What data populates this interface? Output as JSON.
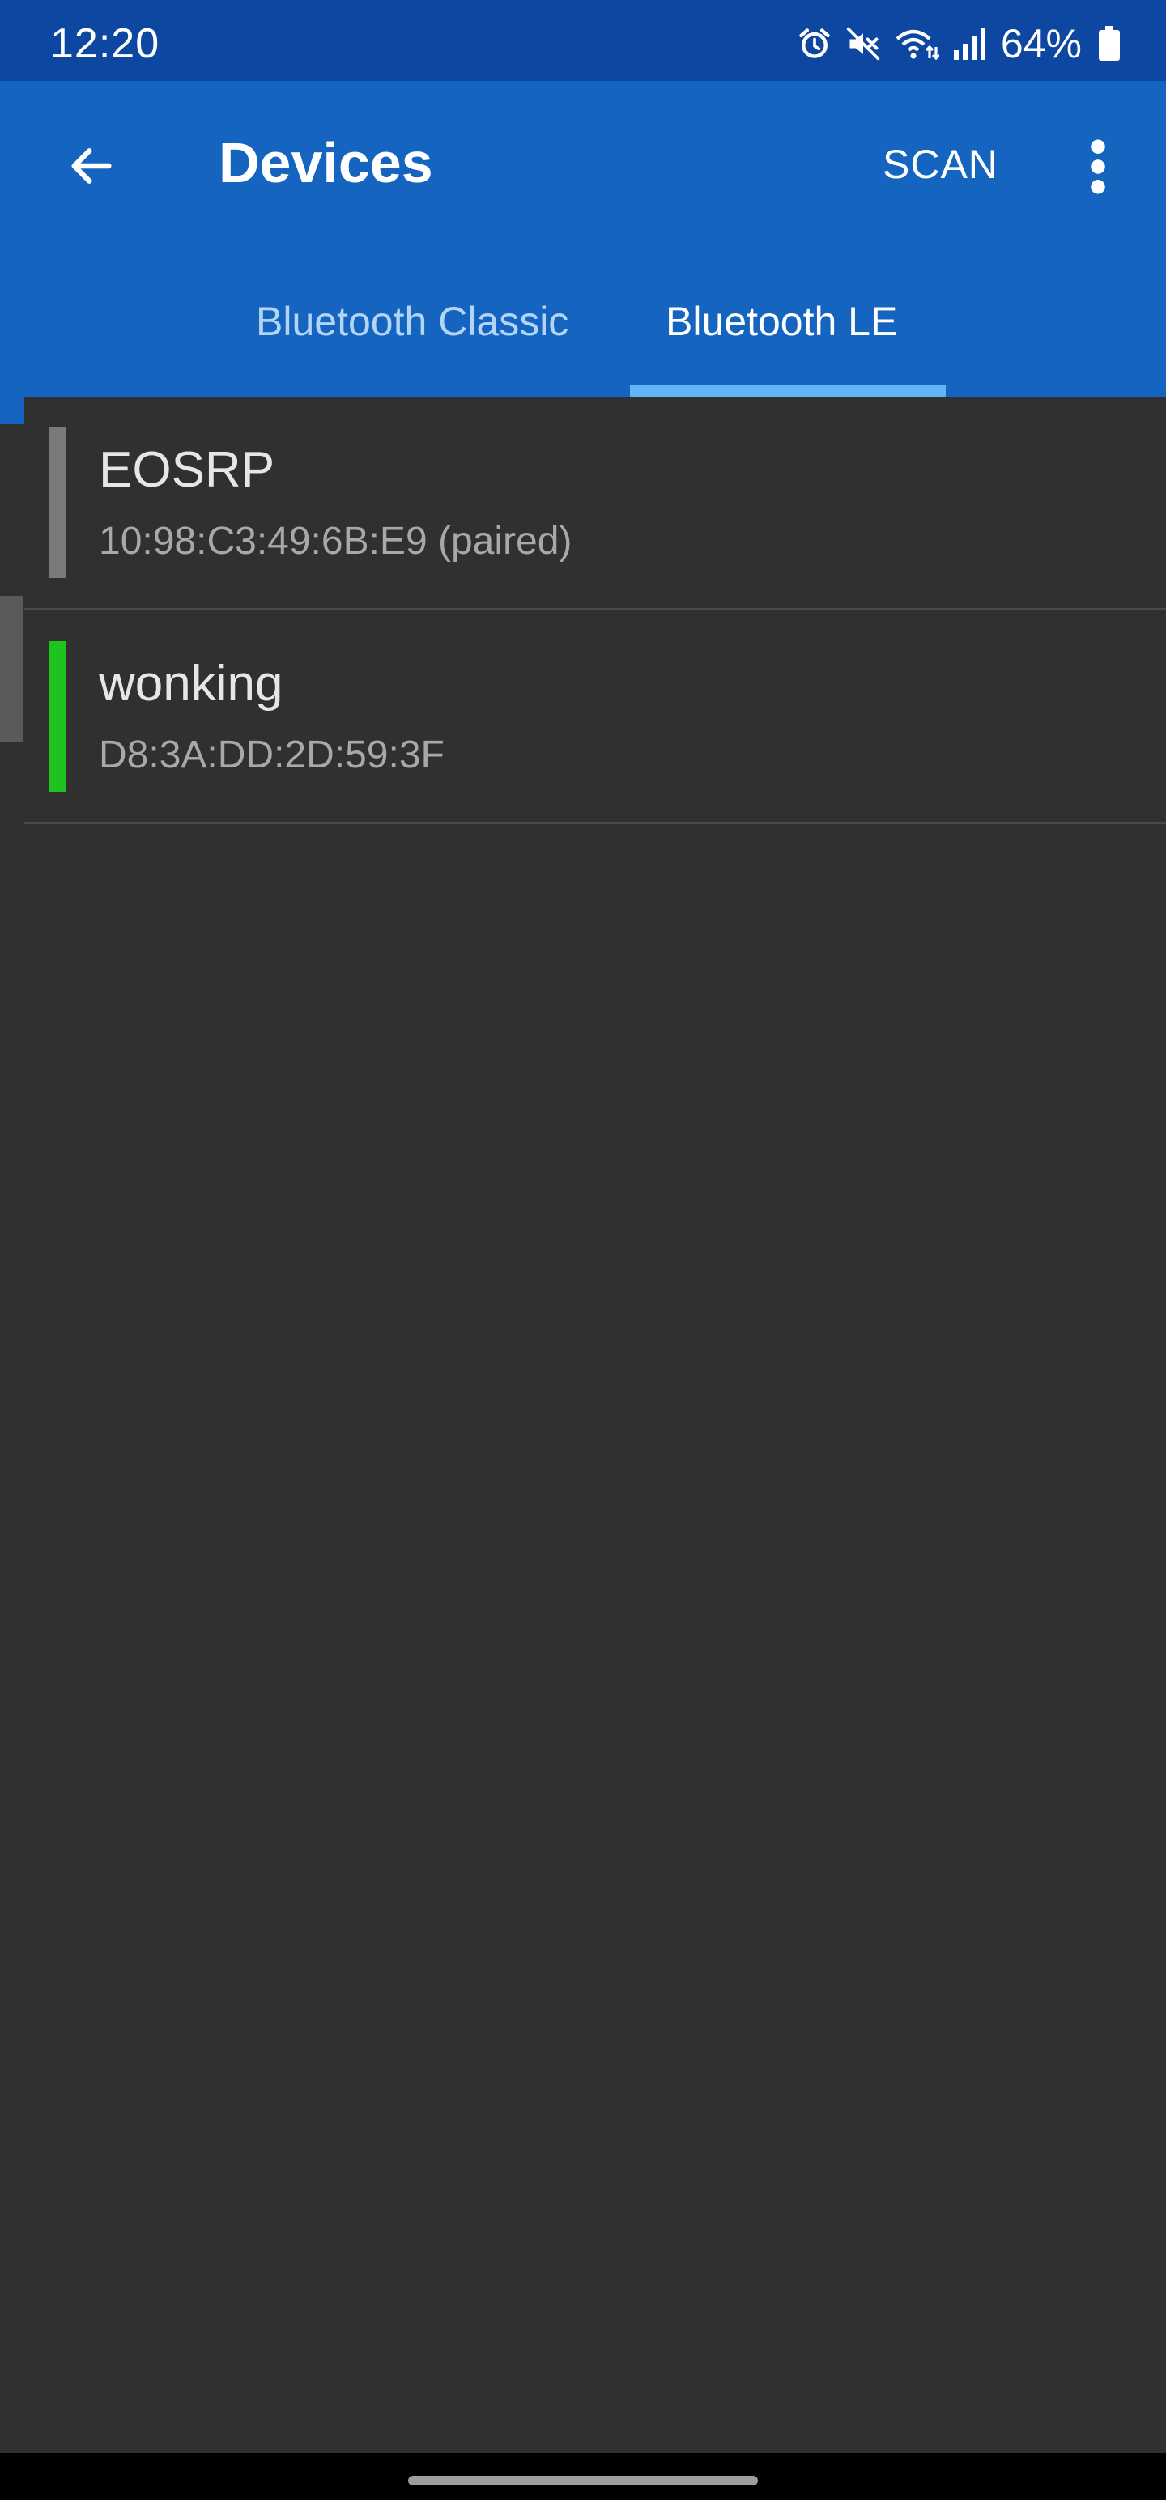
{
  "status_bar": {
    "time": "12:20",
    "battery_percent": "64%",
    "icons": [
      "alarm-icon",
      "mute-icon",
      "wifi-icon",
      "signal-icon",
      "battery-icon"
    ]
  },
  "app_bar": {
    "title": "Devices",
    "scan_label": "SCAN",
    "back_icon": "arrow-back-icon",
    "more_icon": "more-vert-icon"
  },
  "tabs": [
    {
      "label": "Bluetooth Classic",
      "selected": false
    },
    {
      "label": "Bluetooth LE",
      "selected": true
    }
  ],
  "devices": [
    {
      "name": "EOSRP",
      "address": "10:98:C3:49:6B:E9 (paired)",
      "indicator_color": "#7a7a7a"
    },
    {
      "name": "wonking",
      "address": "D8:3A:DD:2D:59:3F",
      "indicator_color": "#1ec31e"
    }
  ],
  "colors": {
    "status_bar": "#0d47a1",
    "app_bar": "#1565c0",
    "tab_indicator": "#64b5f6",
    "background": "#303030"
  }
}
